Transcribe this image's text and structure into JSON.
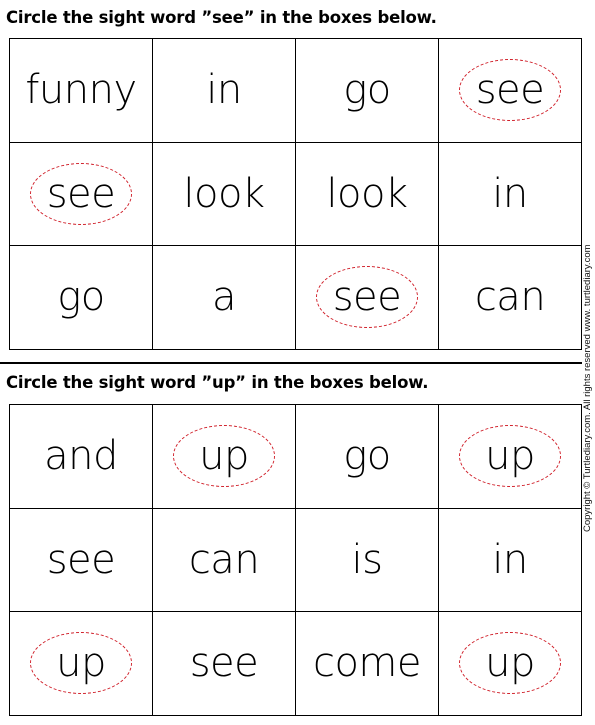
{
  "section1": {
    "instruction": "Circle the sight word ”see” in the boxes below.",
    "target_word": "see",
    "rows": [
      [
        {
          "word": "funny",
          "circled": false
        },
        {
          "word": "in",
          "circled": false
        },
        {
          "word": "go",
          "circled": false
        },
        {
          "word": "see",
          "circled": true
        }
      ],
      [
        {
          "word": "see",
          "circled": true
        },
        {
          "word": "look",
          "circled": false
        },
        {
          "word": "look",
          "circled": false
        },
        {
          "word": "in",
          "circled": false
        }
      ],
      [
        {
          "word": "go",
          "circled": false
        },
        {
          "word": "a",
          "circled": false
        },
        {
          "word": "see",
          "circled": true
        },
        {
          "word": "can",
          "circled": false
        }
      ]
    ]
  },
  "section2": {
    "instruction": "Circle the sight word ”up” in the boxes below.",
    "target_word": "up",
    "rows": [
      [
        {
          "word": "and",
          "circled": false
        },
        {
          "word": "up",
          "circled": true
        },
        {
          "word": "go",
          "circled": false
        },
        {
          "word": "up",
          "circled": true
        }
      ],
      [
        {
          "word": "see",
          "circled": false
        },
        {
          "word": "can",
          "circled": false
        },
        {
          "word": "is",
          "circled": false
        },
        {
          "word": "in",
          "circled": false
        }
      ],
      [
        {
          "word": "up",
          "circled": true
        },
        {
          "word": "see",
          "circled": false
        },
        {
          "word": "come",
          "circled": false
        },
        {
          "word": "up",
          "circled": true
        }
      ]
    ]
  },
  "copyright": "Copyright © Turtlediary.com. All rights reserved   www. turtlediary.com",
  "colors": {
    "circle": "#d0202a",
    "text": "#000000"
  }
}
